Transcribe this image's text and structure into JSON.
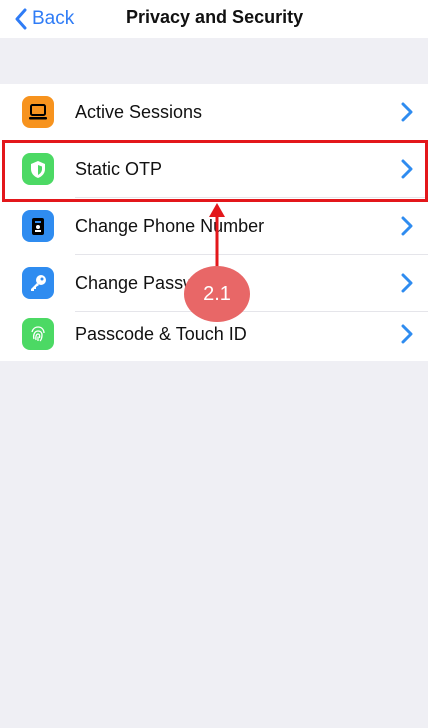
{
  "nav": {
    "back_label": "Back",
    "title": "Privacy and Security"
  },
  "items": [
    {
      "label": "Active Sessions",
      "icon": "laptop-icon",
      "color": "#f7931e"
    },
    {
      "label": "Static OTP",
      "icon": "shield-icon",
      "color": "#4cd964"
    },
    {
      "label": "Change Phone Number",
      "icon": "phone-badge-icon",
      "color": "#2f8cf0"
    },
    {
      "label": "Change Passw",
      "icon": "key-icon",
      "color": "#2f8cf0"
    },
    {
      "label": "Passcode & Touch ID",
      "icon": "fingerprint-icon",
      "color": "#4cd964"
    }
  ],
  "annotation": {
    "step_label": "2.1",
    "highlight_color": "#e3171b",
    "badge_color": "#e86767"
  },
  "colors": {
    "accent": "#2f7cf6",
    "background": "#efeff4"
  }
}
